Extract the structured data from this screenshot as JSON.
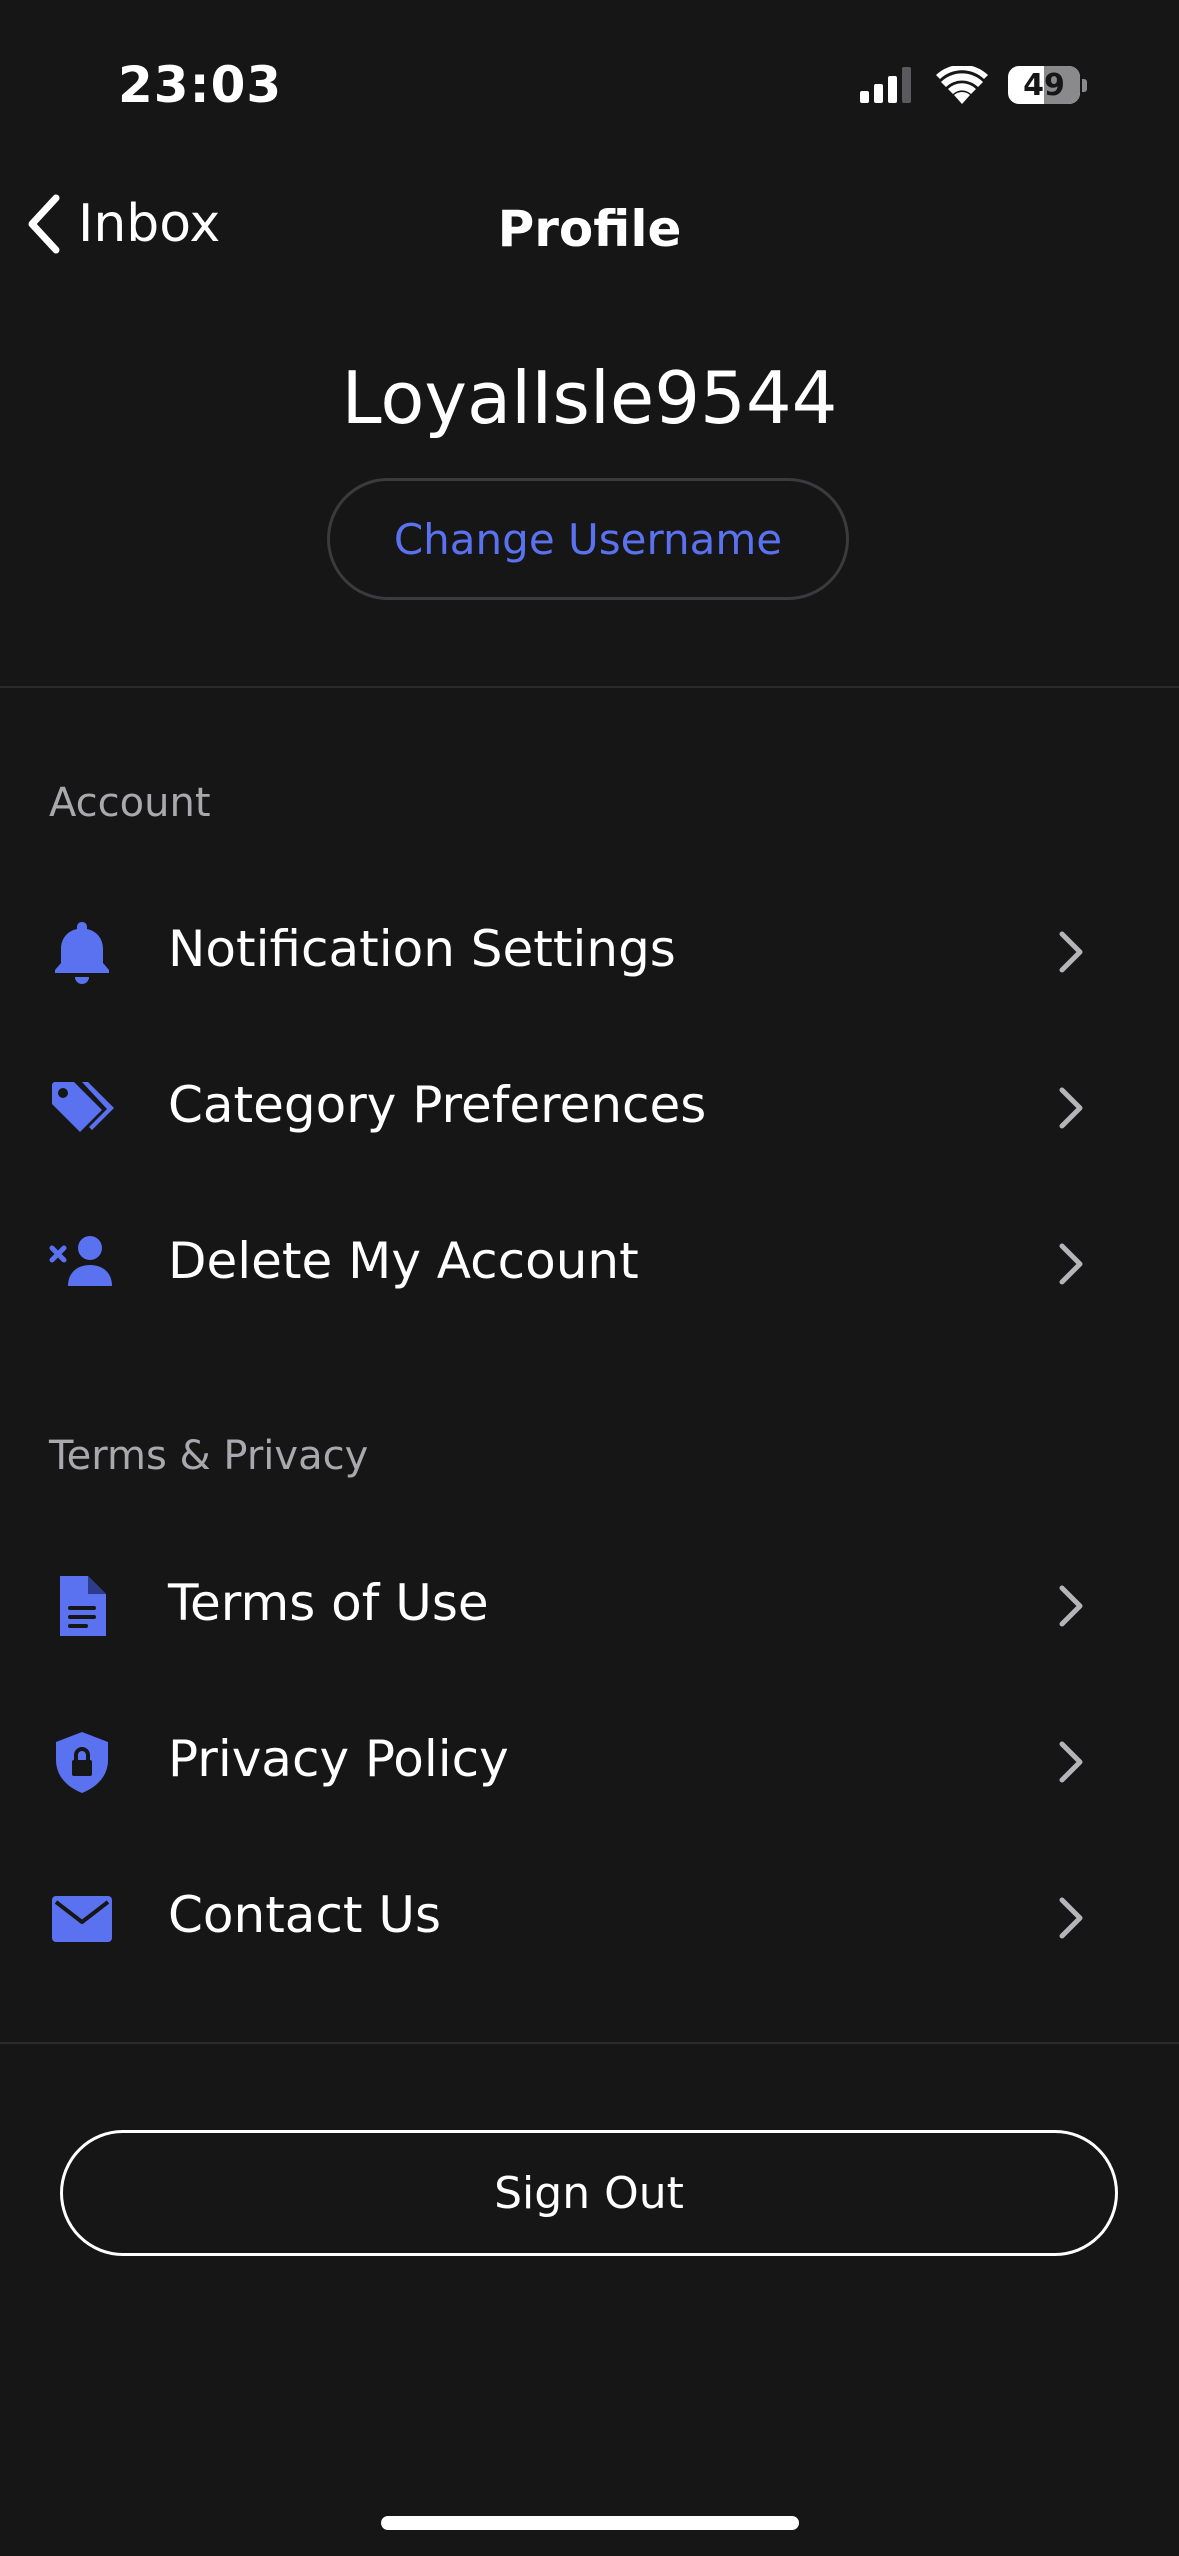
{
  "status_bar": {
    "time": "23:03",
    "battery": "49"
  },
  "nav": {
    "back_label": "Inbox",
    "title": "Profile"
  },
  "profile": {
    "username": "LoyalIsle9544",
    "change_username_label": "Change Username"
  },
  "sections": [
    {
      "label": "Account",
      "items": [
        {
          "label": "Notification Settings",
          "icon": "bell-icon"
        },
        {
          "label": "Category Preferences",
          "icon": "tags-icon"
        },
        {
          "label": "Delete My Account",
          "icon": "remove-user-icon"
        }
      ]
    },
    {
      "label": "Terms & Privacy",
      "items": [
        {
          "label": "Terms of Use",
          "icon": "document-icon"
        },
        {
          "label": "Privacy Policy",
          "icon": "shield-lock-icon"
        },
        {
          "label": "Contact Us",
          "icon": "envelope-icon"
        }
      ]
    }
  ],
  "sign_out_label": "Sign Out",
  "colors": {
    "background": "#161617",
    "accent": "#5a72f0",
    "text": "#ffffff",
    "section_label": "#a9a9ad"
  }
}
